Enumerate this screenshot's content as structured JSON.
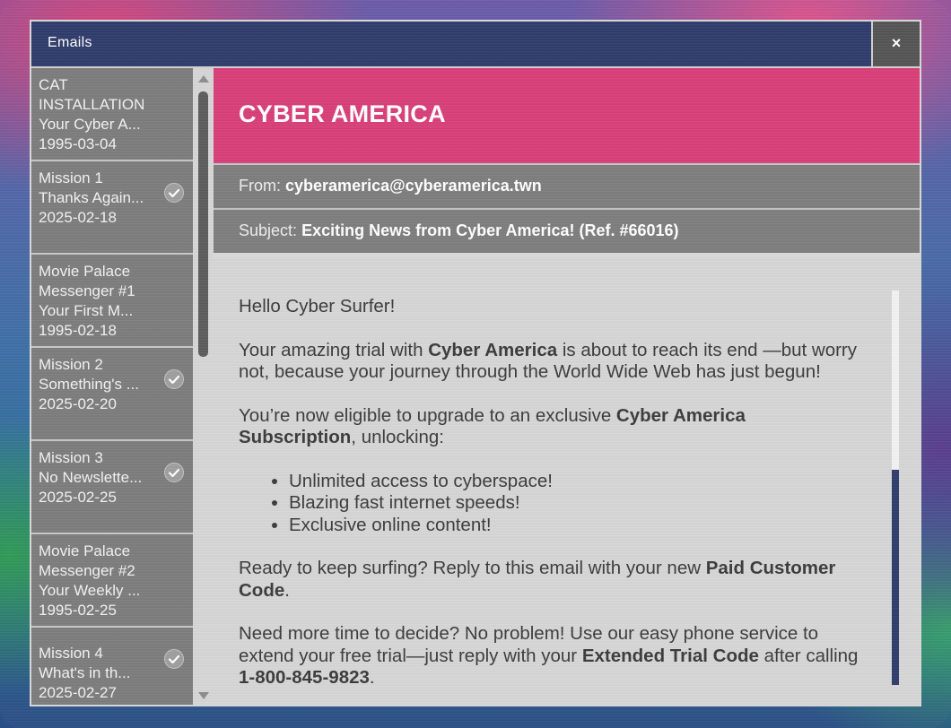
{
  "window": {
    "title": "Emails",
    "close_label": "×"
  },
  "emails": [
    {
      "line1": "CAT",
      "line2": "INSTALLATION",
      "line3": "Your Cyber A...",
      "date": "1995-03-04",
      "read": false
    },
    {
      "line1": "Mission 1",
      "line2": "Thanks Again...",
      "date": "2025-02-18",
      "read": true
    },
    {
      "line1": "Movie Palace",
      "line2": "Messenger #1",
      "line3": "Your First M...",
      "date": "1995-02-18",
      "read": false
    },
    {
      "line1": "Mission 2",
      "line2": "Something's ...",
      "date": "2025-02-20",
      "read": true
    },
    {
      "line1": "Mission 3",
      "line2": "No Newslette...",
      "date": "2025-02-25",
      "read": true
    },
    {
      "line1": "Movie Palace",
      "line2": "Messenger #2",
      "line3": "Your Weekly ...",
      "date": "1995-02-25",
      "read": false
    },
    {
      "line1": "Mission 4",
      "line2": "What's in th...",
      "date": "2025-02-27",
      "read": true
    }
  ],
  "message": {
    "brand": "CYBER AMERICA",
    "from_label": "From:",
    "from_value": "cyberamerica@cyberamerica.twn",
    "subject_label": "Subject:",
    "subject_value": "Exciting News from Cyber America! (Ref. #66016)",
    "greeting": "Hello Cyber Surfer!",
    "p1_a": "Your amazing trial with ",
    "p1_b": "Cyber America",
    "p1_c": " is about to reach its end —but worry not, because your journey through the World Wide Web has just begun!",
    "p2_a": "You’re now eligible to upgrade to an exclusive ",
    "p2_b": "Cyber America Subscription",
    "p2_c": ", unlocking:",
    "bullets": [
      "Unlimited access to cyberspace!",
      "Blazing fast internet speeds!",
      "Exclusive online content!"
    ],
    "p3_a": "Ready to keep surfing? Reply to this email with your new ",
    "p3_b": "Paid Customer Code",
    "p3_c": ".",
    "p4_a": "Need more time to decide? No problem! Use our easy phone service to extend your free trial—just reply with your ",
    "p4_b": "Extended Trial Code",
    "p4_c": " after calling ",
    "p4_d": "1-800-845-9823",
    "p4_e": "."
  },
  "colors": {
    "titlebar": "#2e3b6a",
    "banner": "#d83e78",
    "scroll_thumb_right": "#2e3b6a"
  }
}
